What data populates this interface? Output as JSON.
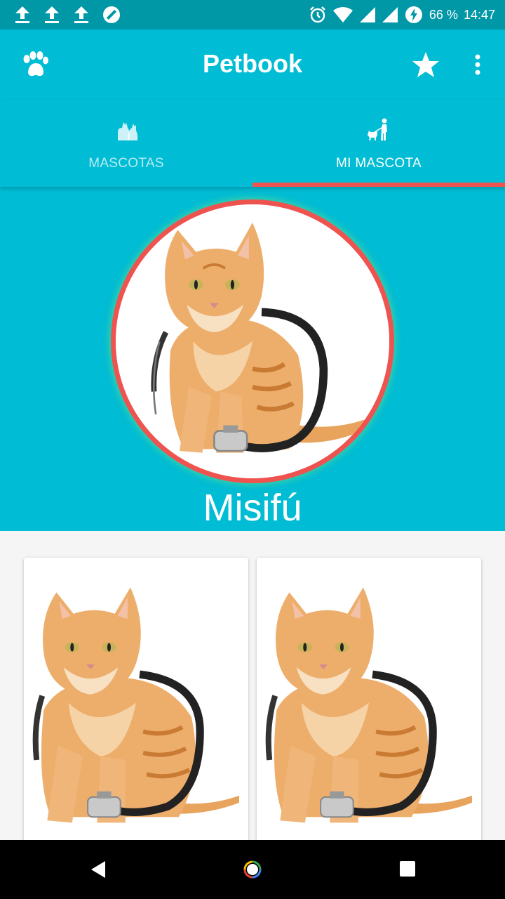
{
  "status_bar": {
    "battery": "66 %",
    "time": "14:47",
    "icons": [
      "upload-icon",
      "upload-icon",
      "upload-icon",
      "blocked-icon",
      "alarm-icon",
      "wifi-icon",
      "signal-icon",
      "signal-icon",
      "battery-charging-icon"
    ]
  },
  "app_bar": {
    "title": "Petbook",
    "icons": [
      "paw-icon",
      "star-icon",
      "more-vert-icon"
    ]
  },
  "tabs": [
    {
      "label": "MASCOTAS",
      "icon": "pets-group-icon",
      "selected": false
    },
    {
      "label": "MI MASCOTA",
      "icon": "person-walking-dog-icon",
      "selected": true
    }
  ],
  "profile": {
    "name": "Misifú",
    "photo": "cat-with-stethoscope"
  },
  "grid": {
    "cards": [
      {
        "photo": "cat-with-stethoscope"
      },
      {
        "photo": "cat-with-stethoscope"
      }
    ]
  },
  "colors": {
    "primary": "#00bcd4",
    "primary_dark": "#0097a7",
    "accent": "#ef5350"
  }
}
